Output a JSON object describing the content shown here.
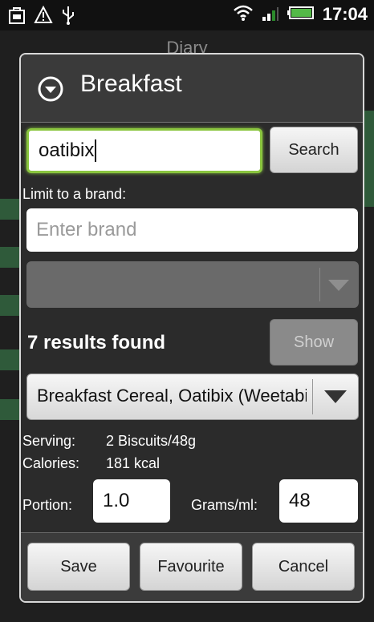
{
  "status_bar": {
    "time": "17:04",
    "icons": [
      "bag-icon",
      "warning-icon",
      "usb-icon",
      "wifi-icon",
      "signal-icon",
      "battery-icon"
    ]
  },
  "background": {
    "title": "Diary"
  },
  "dialog": {
    "title": "Breakfast",
    "header_icon": "chevron-down-circle-icon",
    "search": {
      "value": "oatibix",
      "button_label": "Search"
    },
    "brand": {
      "label": "Limit to a brand:",
      "placeholder": "Enter brand"
    },
    "results": {
      "text": "7 results found",
      "show_label": "Show"
    },
    "selected_food": "Breakfast Cereal, Oatibix (Weetabix)",
    "serving": {
      "label": "Serving:",
      "value": "2 Biscuits/48g"
    },
    "calories": {
      "label": "Calories:",
      "value": "181 kcal"
    },
    "portion": {
      "label": "Portion:",
      "value": "1.0"
    },
    "grams": {
      "label": "Grams/ml:",
      "value": "48"
    },
    "buttons": {
      "save": "Save",
      "favourite": "Favourite",
      "cancel": "Cancel"
    }
  },
  "colors": {
    "focus_accent": "#8ac53f",
    "dialog_bg": "#2b2b2b"
  }
}
